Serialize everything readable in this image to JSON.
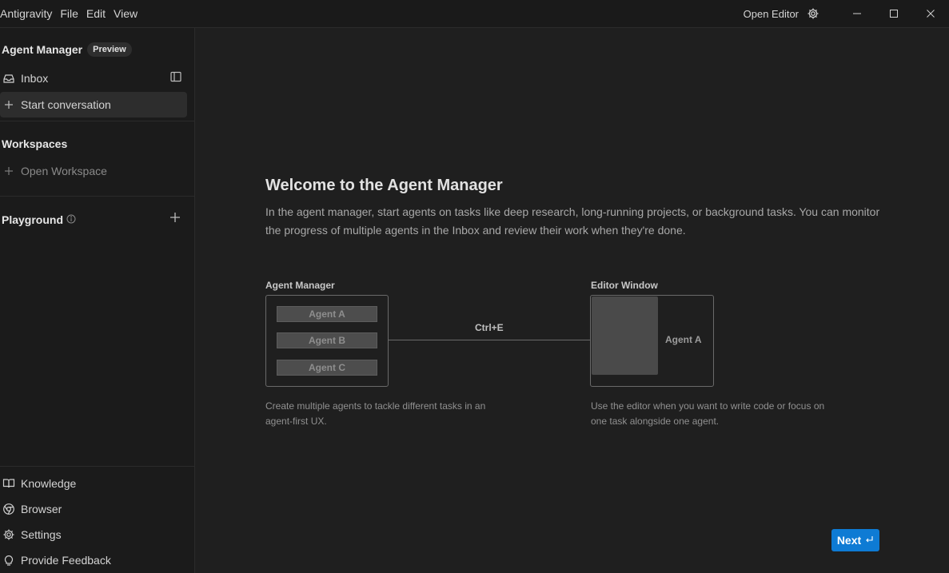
{
  "titlebar": {
    "app_name": "Antigravity",
    "menu": [
      "File",
      "Edit",
      "View"
    ],
    "open_editor": "Open Editor"
  },
  "sidebar": {
    "title": "Agent Manager",
    "badge": "Preview",
    "inbox": "Inbox",
    "start_conversation": "Start conversation",
    "workspaces_title": "Workspaces",
    "open_workspace": "Open Workspace",
    "playground_title": "Playground",
    "bottom_items": [
      "Knowledge",
      "Browser",
      "Settings",
      "Provide Feedback"
    ]
  },
  "main": {
    "title": "Welcome to the Agent Manager",
    "description": "In the agent manager, start agents on tasks like deep research, long-running projects, or background tasks. You can monitor the progress of multiple agents in the Inbox and review their work when they're done.",
    "diagram": {
      "left_label": "Agent Manager",
      "agents": [
        "Agent A",
        "Agent B",
        "Agent C"
      ],
      "shortcut": "Ctrl+E",
      "right_label": "Editor Window",
      "editor_agent": "Agent A",
      "left_caption": "Create multiple agents to tackle different tasks in an agent-first UX.",
      "right_caption": "Use the editor when you want to write code or focus on one task alongside one agent."
    },
    "next_button": "Next"
  },
  "colors": {
    "accent": "#0e7bd4",
    "background": "#1f1f1f",
    "sidebar": "#1b1b1b"
  }
}
